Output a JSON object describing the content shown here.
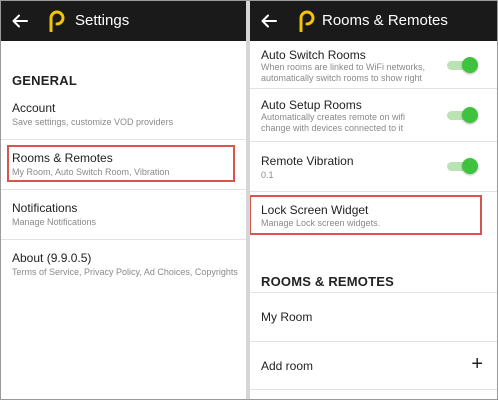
{
  "colors": {
    "appbar": "#1a1a1a",
    "accent_logo": "#f5c400",
    "toggle_on": "#3fc33f",
    "highlight": "#d9534f"
  },
  "left": {
    "title": "Settings",
    "section": "GENERAL",
    "items": [
      {
        "label": "Account",
        "sub": "Save settings, customize VOD providers"
      },
      {
        "label": "Rooms & Remotes",
        "sub": "My Room, Auto Switch Room, Vibration"
      },
      {
        "label": "Notifications",
        "sub": "Manage Notifications"
      },
      {
        "label": "About (9.9.0.5)",
        "sub": "Terms of Service, Privacy Policy, Ad Choices, Copyrights"
      }
    ]
  },
  "right": {
    "title": "Rooms & Remotes",
    "items": [
      {
        "label": "Auto Switch Rooms",
        "sub1": "When rooms are linked to WiFi networks,",
        "sub2": "automatically switch rooms to show right",
        "toggle": true
      },
      {
        "label": "Auto Setup Rooms",
        "sub1": "Automatically creates remote on wifi",
        "sub2": "change with devices connected to it",
        "toggle": true
      },
      {
        "label": "Remote Vibration",
        "sub1": "0.1",
        "toggle": true
      },
      {
        "label": "Lock Screen Widget",
        "sub1": "Manage Lock screen widgets."
      }
    ],
    "section": "ROOMS & REMOTES",
    "rooms": [
      {
        "label": "My Room"
      },
      {
        "label": "Add room",
        "action": "+"
      }
    ]
  }
}
